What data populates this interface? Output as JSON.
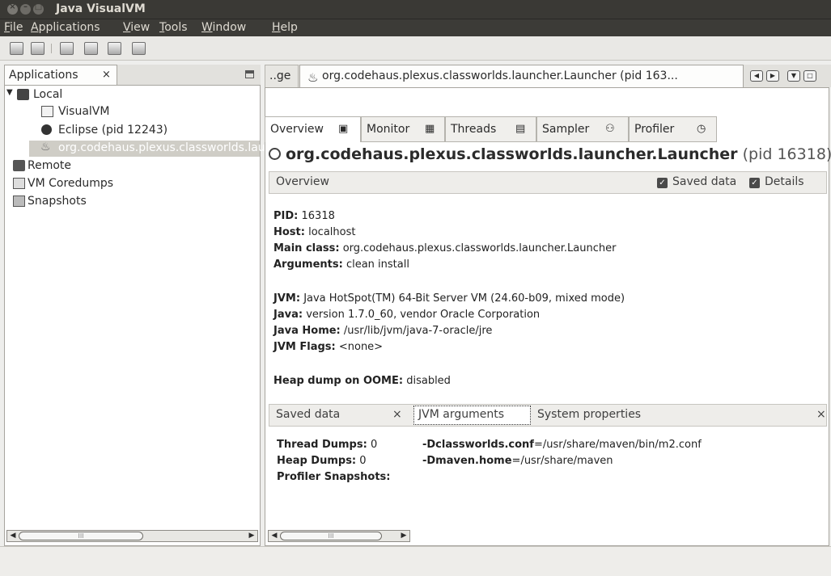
{
  "window": {
    "title": "Java VisualVM"
  },
  "menubar": [
    {
      "underline": "F",
      "rest": "ile"
    },
    {
      "underline": "A",
      "rest": "pplications"
    },
    {
      "underline": "V",
      "rest": "iew"
    },
    {
      "underline": "T",
      "rest": "ools"
    },
    {
      "underline": "W",
      "rest": "indow"
    },
    {
      "underline": "H",
      "rest": "elp"
    }
  ],
  "left_panel": {
    "tab_label": "Applications",
    "tab_close": "×",
    "tree": {
      "local": "Local",
      "visualvm": "VisualVM",
      "eclipse": "Eclipse (pid 12243)",
      "selected": "org.codehaus.plexus.classworlds.launcher.Launcher",
      "remote": "Remote",
      "coredumps": "VM Coredumps",
      "snapshots": "Snapshots"
    },
    "scroll_thumb_label": "III"
  },
  "doc_tabs": {
    "prev_label": "..ge",
    "active_label": "org.codehaus.plexus.classworlds.launcher.Launcher (pid 163..."
  },
  "sub_tabs": {
    "overview": "Overview",
    "monitor": "Monitor",
    "threads": "Threads",
    "sampler": "Sampler",
    "profiler": "Profiler"
  },
  "main": {
    "title_bold": "org.codehaus.plexus.classworlds.launcher.Launcher",
    "title_pid": "(pid 16318)",
    "overview_label": "Overview",
    "saved_data_label": "Saved data",
    "details_label": "Details",
    "info": {
      "pid_key": "PID:",
      "pid_val": "16318",
      "host_key": "Host:",
      "host_val": "localhost",
      "main_key": "Main class:",
      "main_val": "org.codehaus.plexus.classworlds.launcher.Launcher",
      "args_key": "Arguments:",
      "args_val": "clean install",
      "jvm_key": "JVM:",
      "jvm_val": "Java HotSpot(TM) 64-Bit Server VM (24.60-b09, mixed mode)",
      "java_key": "Java:",
      "java_val": "version 1.7.0_60, vendor Oracle Corporation",
      "home_key": "Java Home:",
      "home_val": "/usr/lib/jvm/java-7-oracle/jre",
      "flags_key": "JVM Flags:",
      "flags_val": "<none>",
      "heap_key": "Heap dump on OOME:",
      "heap_val": "disabled"
    }
  },
  "bottom": {
    "saved_data": "Saved data",
    "saved_close": "×",
    "jvm_arguments": "JVM arguments",
    "system_properties": "System properties",
    "sys_close": "×",
    "thread_dumps_key": "Thread Dumps:",
    "thread_dumps_val": "0",
    "heap_dumps_key": "Heap Dumps:",
    "heap_dumps_val": "0",
    "profiler_snapshots_key": "Profiler Snapshots:",
    "arg1_key": "-Dclassworlds.conf",
    "arg1_val": "=/usr/share/maven/bin/m2.conf",
    "arg2_key": "-Dmaven.home",
    "arg2_val": "=/usr/share/maven",
    "scroll_thumb_label": "III"
  }
}
